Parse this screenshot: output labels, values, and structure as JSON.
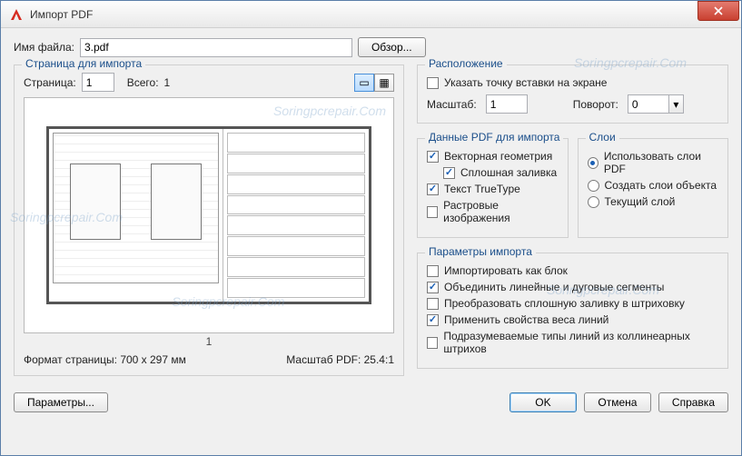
{
  "window": {
    "title": "Импорт PDF"
  },
  "file": {
    "label": "Имя файла:",
    "value": "3.pdf",
    "browse": "Обзор..."
  },
  "page_import": {
    "legend": "Страница для импорта",
    "page_label": "Страница:",
    "page_value": "1",
    "total_label": "Всего:",
    "total_value": "1",
    "page_number": "1",
    "format_label": "Формат страницы:",
    "format_value": "700 x  297 мм",
    "scale_label": "Масштаб PDF:",
    "scale_value": "25.4:1"
  },
  "location": {
    "legend": "Расположение",
    "pick_point": "Указать точку вставки на экране",
    "scale_label": "Масштаб:",
    "scale_value": "1",
    "rotation_label": "Поворот:",
    "rotation_value": "0"
  },
  "pdf_data": {
    "legend": "Данные PDF для импорта",
    "vector": "Векторная геометрия",
    "solid": "Сплошная заливка",
    "truetype": "Текст TrueType",
    "raster": "Растровые изображения"
  },
  "layers": {
    "legend": "Слои",
    "use_pdf": "Использовать слои PDF",
    "create_obj": "Создать слои объекта",
    "current": "Текущий слой"
  },
  "import_params": {
    "legend": "Параметры импорта",
    "as_block": "Импортировать как блок",
    "join": "Объединить линейные и дуговые сегменты",
    "convert_solid": "Преобразовать сплошную заливку в штриховку",
    "apply_lw": "Применить свойства веса линий",
    "implied_lt": "Подразумеваемые типы линий из коллинеарных штрихов"
  },
  "footer": {
    "params": "Параметры...",
    "ok": "OK",
    "cancel": "Отмена",
    "help": "Справка"
  },
  "watermark": "Soringpcrepair.Com"
}
